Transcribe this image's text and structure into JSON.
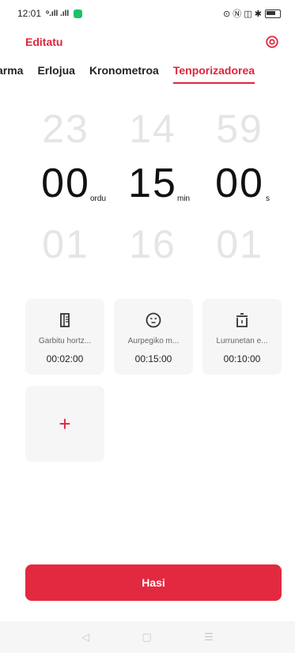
{
  "status": {
    "time": "12:01",
    "signal": "ᵒ.ıll .ıll",
    "right_icons": "⊙ Ⓝ ◫ ✱"
  },
  "header": {
    "edit_label": "Editatu"
  },
  "tabs": [
    {
      "label": "Alarma"
    },
    {
      "label": "Erlojua"
    },
    {
      "label": "Kronometroa"
    },
    {
      "label": "Tenporizadorea"
    }
  ],
  "picker": {
    "hours": {
      "prev": "23",
      "value": "00",
      "next": "01",
      "unit": "ordu"
    },
    "minutes": {
      "prev": "14",
      "value": "15",
      "next": "16",
      "unit": "min"
    },
    "seconds": {
      "prev": "59",
      "value": "00",
      "next": "01",
      "unit": "s"
    }
  },
  "presets": [
    {
      "name": "Garbitu hortz...",
      "time": "00:02:00",
      "icon": "toothbrush-icon"
    },
    {
      "name": "Aurpegiko m...",
      "time": "00:15:00",
      "icon": "face-mask-icon"
    },
    {
      "name": "Lurrunetan e...",
      "time": "00:10:00",
      "icon": "steamer-pot-icon"
    }
  ],
  "add_label": "+",
  "start_label": "Hasi",
  "nav": {
    "back": "◁",
    "home": "▢",
    "menu": "☰"
  },
  "colors": {
    "accent": "#e0243a"
  }
}
